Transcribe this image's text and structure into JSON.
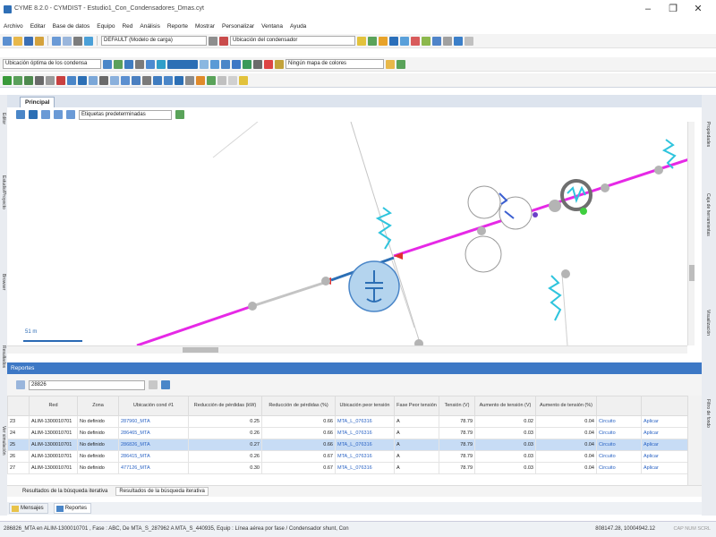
{
  "window": {
    "title": "CYME 8.2.0 - CYMDIST - Estudio1_Con_Condensadores_Dmas.cyt",
    "minimize": "–",
    "maximize": "❐",
    "close": "✕"
  },
  "menu": [
    "Archivo",
    "Editar",
    "Base de datos",
    "Equipo",
    "Red",
    "Análisis",
    "Reporte",
    "Mostrar",
    "Personalizar",
    "Ventana",
    "Ayuda"
  ],
  "toolbar1": {
    "load_model": "DEFAULT (Modelo de carga)",
    "location_combo": "Ubicación del condensador"
  },
  "toolbar2": {
    "location_combo": "Ubicación óptima de los condensa",
    "color_map": "Ningún mapa de colores"
  },
  "side_panels": {
    "left": [
      "Editor",
      "Estudio/Proyecto",
      "Browser",
      "Resultados",
      "Ver simulación"
    ],
    "right": [
      "Propiedades",
      "Caja de herramientas",
      "Visualización",
      "Filtro de fondo"
    ]
  },
  "tabs": {
    "principal": "Principal"
  },
  "canvas_toolbar": {
    "labels_combo": "Etiquetas predeterminadas"
  },
  "canvas": {
    "scale_label": "51 m"
  },
  "reports": {
    "title": "Reportes",
    "search_value": "28826",
    "columns": [
      "",
      "Red",
      "Zona",
      "Ubicación cond #1",
      "Reducción de pérdidas (kW)",
      "Reducción de pérdidas (%)",
      "Ubicación peor tensión",
      "Fase Peor tensión",
      "Tensión (V)",
      "Aumento de tensión (V)",
      "Aumento de tensión (%)",
      "",
      ""
    ],
    "rows": [
      [
        "23",
        "ALIM-1300010701",
        "No definido",
        "287960_MTA",
        "0.25",
        "0.66",
        "MTA_L_076316",
        "A",
        "78.79",
        "0.02",
        "0.04",
        "Circuito",
        "Aplicar"
      ],
      [
        "24",
        "ALIM-1300010701",
        "No definido",
        "286465_MTA",
        "0.26",
        "0.66",
        "MTA_L_076316",
        "A",
        "78.79",
        "0.03",
        "0.04",
        "Circuito",
        "Aplicar"
      ],
      [
        "25",
        "ALIM-1300010701",
        "No definido",
        "286826_MTA",
        "0.27",
        "0.66",
        "MTA_L_076316",
        "A",
        "78.79",
        "0.03",
        "0.04",
        "Circuito",
        "Aplicar"
      ],
      [
        "26",
        "ALIM-1300010701",
        "No definido",
        "286415_MTA",
        "0.26",
        "0.67",
        "MTA_L_076316",
        "A",
        "78.79",
        "0.03",
        "0.04",
        "Circuito",
        "Aplicar"
      ],
      [
        "27",
        "ALIM-1300010701",
        "No definido",
        "477126_MTA",
        "0.30",
        "0.67",
        "MTA_L_076316",
        "A",
        "78.79",
        "0.03",
        "0.04",
        "Circuito",
        "Aplicar"
      ]
    ],
    "selected_row": 2,
    "result_tabs": [
      "Resultados de la búsqueda iterativa",
      "Resultados de la búsqueda iterativa"
    ],
    "bottom_tabs": [
      "Mensajes",
      "Reportes"
    ]
  },
  "status": {
    "text": "286826_MTA en ALIM-1300010701 , Fase : ABC, De MTA_S_287962 A MTA_S_440935, Equip : Línea aérea por fase / Condensador shunt, Con",
    "coords": "808147.28, 10004942.12",
    "keys": "CAP NUM SCRL"
  },
  "colors": {
    "feeder_line": "#e629e6",
    "selected_section": "#2c6fb5",
    "accent": "#3d78c5",
    "capacitor_symbol": "#2ec4dd"
  }
}
